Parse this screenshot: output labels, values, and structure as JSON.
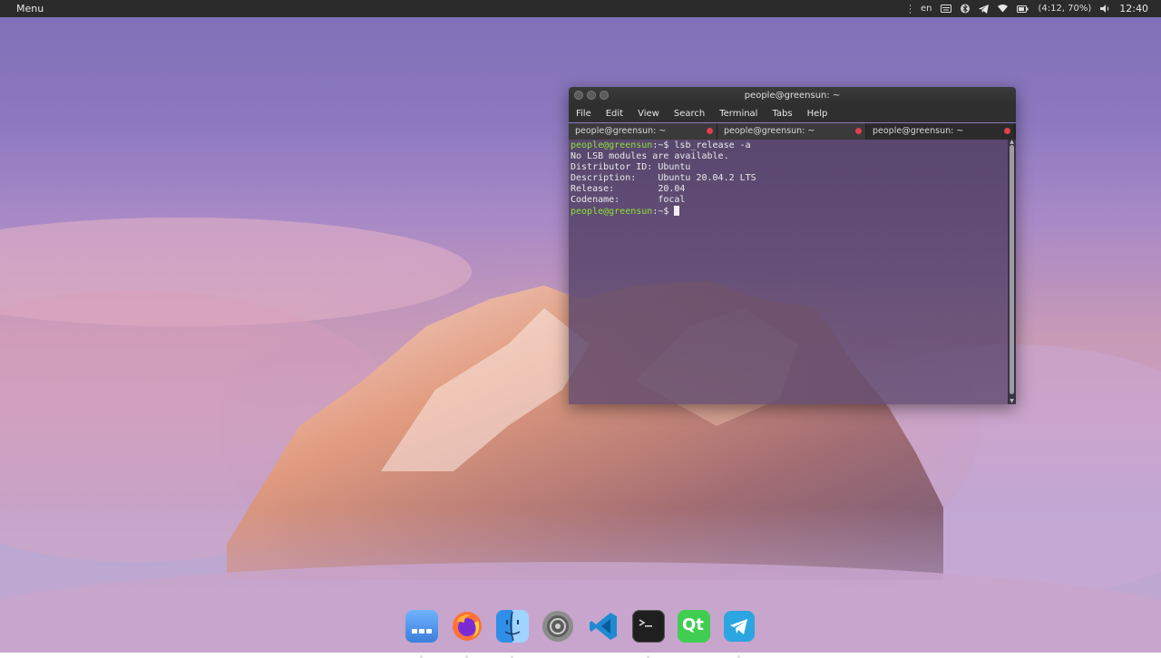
{
  "topbar": {
    "menu_label": "Menu",
    "language": "en",
    "battery": "(4:12, 70%)",
    "clock": "12:40",
    "tray_icons": [
      "keyboard-icon",
      "bluetooth-icon",
      "telegram-tray-icon",
      "wifi-icon",
      "battery-icon",
      "volume-icon"
    ]
  },
  "terminal": {
    "title": "people@greensun: ~",
    "menu": [
      "File",
      "Edit",
      "View",
      "Search",
      "Terminal",
      "Tabs",
      "Help"
    ],
    "tabs": [
      "people@greensun: ~",
      "people@greensun: ~",
      "people@greensun: ~"
    ],
    "prompt": "people@greensun",
    "lines": [
      {
        "prompt": "people@greensun",
        "path": ":~$ ",
        "text": "lsb_release -a"
      },
      {
        "text": "No LSB modules are available."
      },
      {
        "text": "Distributor ID:\tUbuntu"
      },
      {
        "text": "Description:\tUbuntu 20.04.2 LTS"
      },
      {
        "text": "Release:\t20.04"
      },
      {
        "text": "Codename:\tfocal"
      },
      {
        "prompt": "people@greensun",
        "path": ":~$ ",
        "text": ""
      }
    ]
  },
  "dock": {
    "apps": [
      {
        "name": "app-launcher",
        "color": "#4a90e2"
      },
      {
        "name": "firefox",
        "color": "#ff7139"
      },
      {
        "name": "finder",
        "color": "#3aa0f0"
      },
      {
        "name": "settings",
        "color": "#7a7a7a"
      },
      {
        "name": "vscode",
        "color": "#1e88e5"
      },
      {
        "name": "terminal",
        "color": "#222222"
      },
      {
        "name": "qt-creator",
        "color": "#41cd52"
      },
      {
        "name": "telegram",
        "color": "#2ca5e0"
      }
    ],
    "qt_label": "Qt"
  }
}
